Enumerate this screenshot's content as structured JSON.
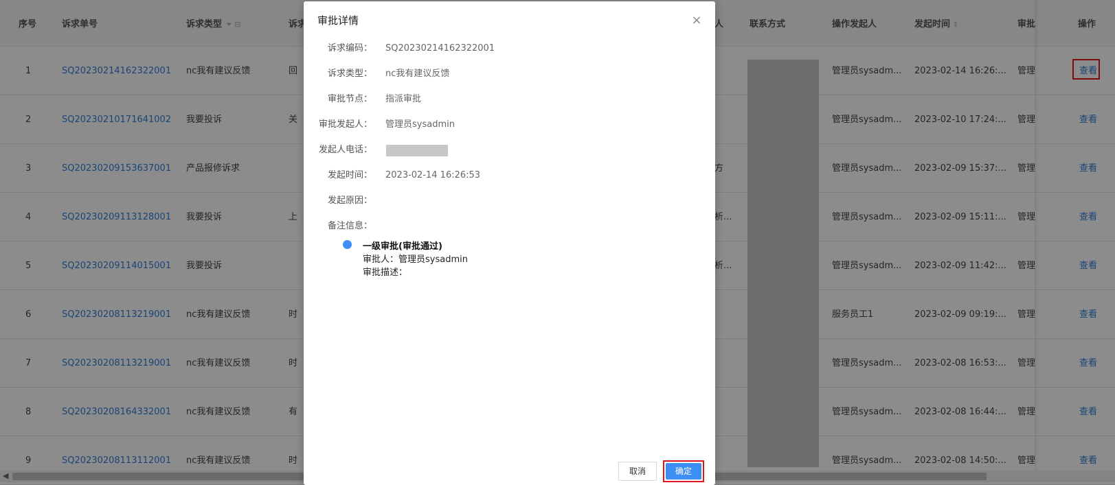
{
  "table": {
    "headers": {
      "seq": "序号",
      "order_no": "诉求单号",
      "type": "诉求类型",
      "col4": "诉求",
      "col_person_tail": "人",
      "contact": "联系方式",
      "operator": "操作发起人",
      "time": "发起时间",
      "approval": "审批",
      "action": "操作"
    },
    "rows": [
      {
        "seq": "1",
        "order_no": "SQ20230214162322001",
        "type": "nc我有建议反馈",
        "col4": "回",
        "mid": "",
        "operator": "管理员sysadm...",
        "time": "2023-02-14 16:26:...",
        "approval": "管理",
        "action": "查看"
      },
      {
        "seq": "2",
        "order_no": "SQ20230210171641002",
        "type": "我要投诉",
        "col4": "关",
        "mid": "",
        "operator": "管理员sysadm...",
        "time": "2023-02-10 17:24:...",
        "approval": "管理",
        "action": "查看"
      },
      {
        "seq": "3",
        "order_no": "SQ20230209153637001",
        "type": "产品报修诉求",
        "col4": "",
        "mid": "方",
        "operator": "管理员sysadm...",
        "time": "2023-02-09 15:37:...",
        "approval": "管理",
        "action": "查看"
      },
      {
        "seq": "4",
        "order_no": "SQ20230209113128001",
        "type": "我要投诉",
        "col4": "上",
        "mid": "析...",
        "operator": "管理员sysadm...",
        "time": "2023-02-09 15:11:...",
        "approval": "管理",
        "action": "查看"
      },
      {
        "seq": "5",
        "order_no": "SQ20230209114015001",
        "type": "我要投诉",
        "col4": "",
        "mid": "析...",
        "operator": "管理员sysadm...",
        "time": "2023-02-09 11:42:...",
        "approval": "管理",
        "action": "查看"
      },
      {
        "seq": "6",
        "order_no": "SQ20230208113219001",
        "type": "nc我有建议反馈",
        "col4": "时",
        "mid": "",
        "operator": "服务员工1",
        "time": "2023-02-09 09:19:...",
        "approval": "管理",
        "action": "查看"
      },
      {
        "seq": "7",
        "order_no": "SQ20230208113219001",
        "type": "nc我有建议反馈",
        "col4": "时",
        "mid": "",
        "operator": "管理员sysadm...",
        "time": "2023-02-08 16:53:...",
        "approval": "管理",
        "action": "查看"
      },
      {
        "seq": "8",
        "order_no": "SQ20230208164332001",
        "type": "nc我有建议反馈",
        "col4": "有",
        "mid": "",
        "operator": "管理员sysadm...",
        "time": "2023-02-08 16:44:...",
        "approval": "管理",
        "action": "查看"
      },
      {
        "seq": "9",
        "order_no": "SQ20230208113112001",
        "type": "nc我有建议反馈",
        "col4": "时",
        "mid": "",
        "operator": "管理员sysadm...",
        "time": "2023-02-08 14:50:...",
        "approval": "管理",
        "action": "查看"
      }
    ]
  },
  "modal": {
    "title": "审批详情",
    "close_icon": "close-icon",
    "fields": [
      {
        "label": "诉求编码：",
        "value": "SQ20230214162322001"
      },
      {
        "label": "诉求类型：",
        "value": "nc我有建议反馈"
      },
      {
        "label": "审批节点：",
        "value": "指派审批"
      },
      {
        "label": "审批发起人：",
        "value": "管理员sysadmin"
      },
      {
        "label": "发起人电话：",
        "value": ""
      },
      {
        "label": "发起时间：",
        "value": "2023-02-14 16:26:53"
      },
      {
        "label": "发起原因：",
        "value": ""
      },
      {
        "label": "备注信息：",
        "value": ""
      }
    ],
    "timeline": {
      "title": "一级审批(审批通过)",
      "approver": "审批人：管理员sysadmin",
      "description": "审批描述："
    },
    "cancel_label": "取消",
    "ok_label": "确定",
    "accent_color": "#3d8ff5",
    "highlight_color": "#e0141e"
  }
}
